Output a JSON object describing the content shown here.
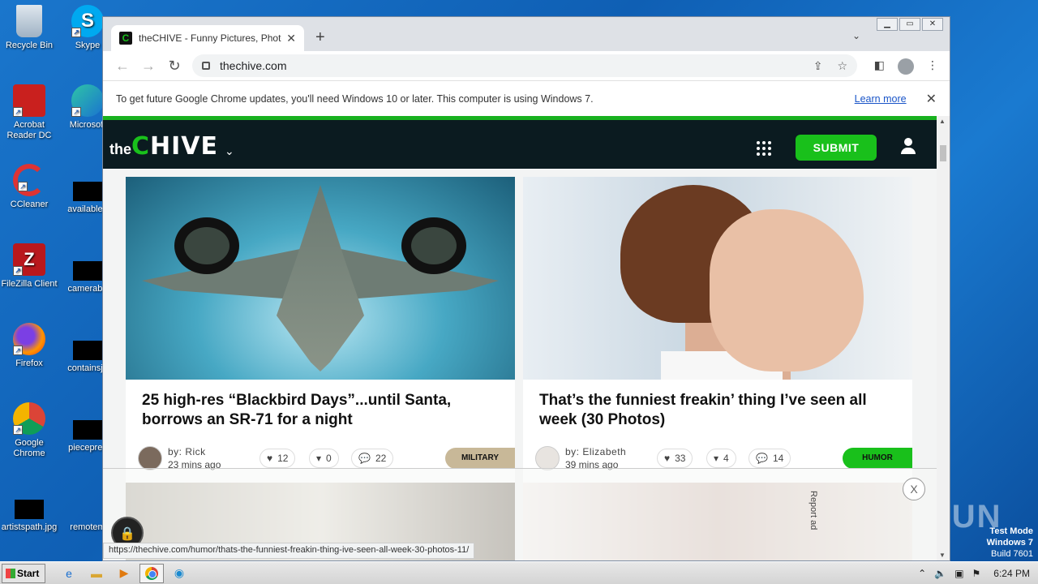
{
  "desktop": {
    "icons": [
      {
        "label": "Recycle Bin"
      },
      {
        "label": "Skype"
      },
      {
        "label": "Acrobat Reader DC"
      },
      {
        "label": "Microsoft"
      },
      {
        "label": "CCleaner"
      },
      {
        "label": "availablea"
      },
      {
        "label": "FileZilla Client"
      },
      {
        "label": "camerabir"
      },
      {
        "label": "Firefox"
      },
      {
        "label": "containsja"
      },
      {
        "label": "Google Chrome"
      },
      {
        "label": "piecepres"
      },
      {
        "label": "artistspath.jpg"
      },
      {
        "label": "remotem"
      }
    ]
  },
  "browser": {
    "tab_title": "theCHIVE - Funny Pictures, Photos, ",
    "tab_favicon": "C",
    "url": "thechive.com",
    "infobar": {
      "message": "To get future Google Chrome updates, you'll need Windows 10 or later. This computer is using Windows 7.",
      "link": "Learn more"
    },
    "status_url": "https://thechive.com/humor/thats-the-funniest-freakin-thing-ive-seen-all-week-30-photos-11/"
  },
  "site": {
    "logo_the": "the",
    "logo_c": "C",
    "logo_rest": "HIVE",
    "submit_label": "SUBMIT",
    "accent": "#19c01b"
  },
  "cards": [
    {
      "headline": "25 high-res “Blackbird Days”...until Santa, borrows an SR-71 for a night",
      "author": "by: Rick",
      "time": "23 mins ago",
      "likes": "12",
      "dislikes": "0",
      "comments": "22",
      "tag": "MILITARY",
      "tag_color": "#c8b898"
    },
    {
      "headline": "That’s the funniest freakin’ thing I’ve seen all week (30 Photos)",
      "author": "by: Elizabeth",
      "time": "39 mins ago",
      "likes": "33",
      "dislikes": "4",
      "comments": "14",
      "tag": "HUMOR",
      "tag_color": "#19c01b"
    }
  ],
  "ad": {
    "report_label": "Report ad",
    "close_label": "X"
  },
  "watermark": {
    "text": "ANY RUN",
    "line1": "Test Mode",
    "line2": "Windows 7",
    "line3": "Build 7601"
  },
  "taskbar": {
    "start_label": "Start",
    "clock": "6:24 PM"
  }
}
